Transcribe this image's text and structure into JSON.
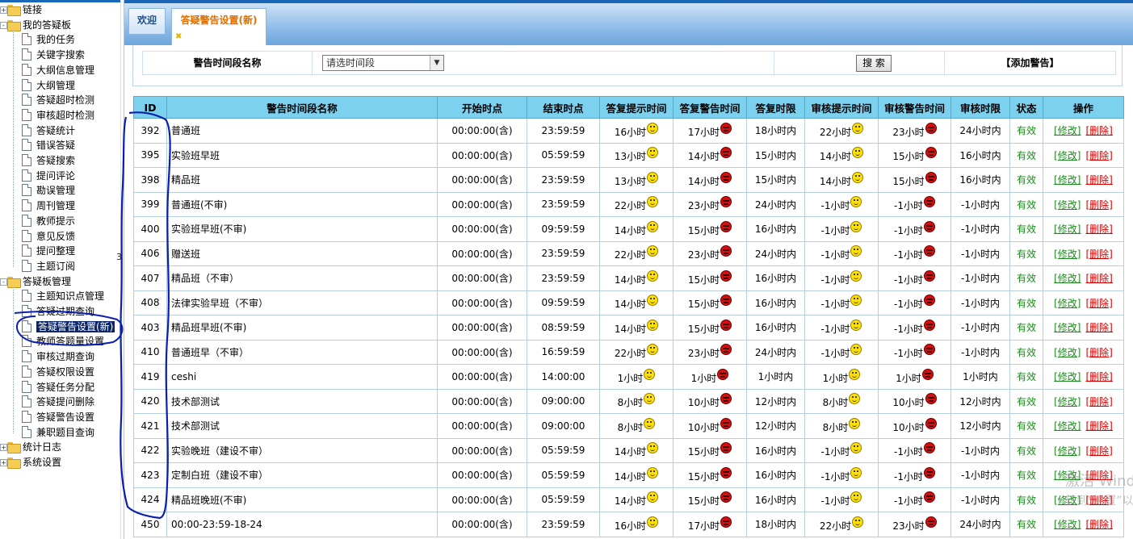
{
  "sidebar": {
    "nodes": [
      {
        "label": "链接",
        "kind": "folder",
        "level": 0,
        "expander": "+"
      },
      {
        "label": "我的答疑板",
        "kind": "folder",
        "level": 0,
        "expander": "-"
      },
      {
        "label": "我的任务",
        "kind": "doc",
        "level": 1
      },
      {
        "label": "关键字搜索",
        "kind": "doc",
        "level": 1
      },
      {
        "label": "大纲信息管理",
        "kind": "doc",
        "level": 1
      },
      {
        "label": "大纲管理",
        "kind": "doc",
        "level": 1
      },
      {
        "label": "答疑超时检测",
        "kind": "doc",
        "level": 1
      },
      {
        "label": "审核超时检测",
        "kind": "doc",
        "level": 1
      },
      {
        "label": "答疑统计",
        "kind": "doc",
        "level": 1
      },
      {
        "label": "错误答疑",
        "kind": "doc",
        "level": 1
      },
      {
        "label": "答疑搜索",
        "kind": "doc",
        "level": 1
      },
      {
        "label": "提问评论",
        "kind": "doc",
        "level": 1
      },
      {
        "label": "勘误管理",
        "kind": "doc",
        "level": 1
      },
      {
        "label": "周刊管理",
        "kind": "doc",
        "level": 1
      },
      {
        "label": "教师提示",
        "kind": "doc",
        "level": 1
      },
      {
        "label": "意见反馈",
        "kind": "doc",
        "level": 1
      },
      {
        "label": "提问整理",
        "kind": "doc",
        "level": 1
      },
      {
        "label": "主题订阅",
        "kind": "doc",
        "level": 1
      },
      {
        "label": "答疑板管理",
        "kind": "folder",
        "level": 0,
        "expander": "-"
      },
      {
        "label": "主题知识点管理",
        "kind": "doc",
        "level": 1
      },
      {
        "label": "答疑过期查询",
        "kind": "doc",
        "level": 1
      },
      {
        "label": "答疑警告设置(新)",
        "kind": "doc",
        "level": 1,
        "active": true
      },
      {
        "label": "教师答题量设置",
        "kind": "doc",
        "level": 1
      },
      {
        "label": "审核过期查询",
        "kind": "doc",
        "level": 1
      },
      {
        "label": "答疑权限设置",
        "kind": "doc",
        "level": 1
      },
      {
        "label": "答疑任务分配",
        "kind": "doc",
        "level": 1
      },
      {
        "label": "答疑提问删除",
        "kind": "doc",
        "level": 1
      },
      {
        "label": "答疑警告设置",
        "kind": "doc",
        "level": 1
      },
      {
        "label": "兼职题目查询",
        "kind": "doc",
        "level": 1
      },
      {
        "label": "统计日志",
        "kind": "folder",
        "level": 0,
        "expander": "+"
      },
      {
        "label": "系统设置",
        "kind": "folder",
        "level": 0,
        "expander": "+"
      }
    ]
  },
  "tabs": {
    "welcome": "欢迎",
    "active": "答疑警告设置(新)",
    "close_glyph": "✖"
  },
  "search": {
    "label": "警告时间段名称",
    "select_value": "请选时间段",
    "button": "搜 索",
    "add_link": "【添加警告】"
  },
  "table": {
    "headers": [
      "ID",
      "警告时间段名称",
      "开始时点",
      "结束时点",
      "答复提示时间",
      "答复警告时间",
      "答复时限",
      "审核提示时间",
      "审核警告时间",
      "审核时限",
      "状态",
      "操作"
    ],
    "modify_label": "[修改]",
    "delete_label": "[删除]",
    "rows": [
      {
        "id": "392",
        "name": "普通班",
        "start": "00:00:00(含)",
        "end": "23:59:59",
        "reply_hint": "16小时",
        "reply_warn": "17小时",
        "reply_limit": "18小时内",
        "audit_hint": "22小时",
        "audit_warn": "23小时",
        "audit_limit": "24小时内",
        "status": "有效"
      },
      {
        "id": "395",
        "name": "实验班早班",
        "start": "00:00:00(含)",
        "end": "05:59:59",
        "reply_hint": "13小时",
        "reply_warn": "14小时",
        "reply_limit": "15小时内",
        "audit_hint": "14小时",
        "audit_warn": "15小时",
        "audit_limit": "16小时内",
        "status": "有效"
      },
      {
        "id": "398",
        "name": "精品班",
        "start": "00:00:00(含)",
        "end": "23:59:59",
        "reply_hint": "13小时",
        "reply_warn": "14小时",
        "reply_limit": "15小时内",
        "audit_hint": "14小时",
        "audit_warn": "15小时",
        "audit_limit": "16小时内",
        "status": "有效"
      },
      {
        "id": "399",
        "name": "普通班(不审)",
        "start": "00:00:00(含)",
        "end": "23:59:59",
        "reply_hint": "22小时",
        "reply_warn": "23小时",
        "reply_limit": "24小时内",
        "audit_hint": "-1小时",
        "audit_warn": "-1小时",
        "audit_limit": "-1小时内",
        "status": "有效"
      },
      {
        "id": "400",
        "name": "实验班早班(不审)",
        "start": "00:00:00(含)",
        "end": "09:59:59",
        "reply_hint": "14小时",
        "reply_warn": "15小时",
        "reply_limit": "16小时内",
        "audit_hint": "-1小时",
        "audit_warn": "-1小时",
        "audit_limit": "-1小时内",
        "status": "有效"
      },
      {
        "id": "406",
        "name": "赠送班",
        "start": "00:00:00(含)",
        "end": "23:59:59",
        "reply_hint": "22小时",
        "reply_warn": "23小时",
        "reply_limit": "24小时内",
        "audit_hint": "-1小时",
        "audit_warn": "-1小时",
        "audit_limit": "-1小时内",
        "status": "有效"
      },
      {
        "id": "407",
        "name": "精品班（不审）",
        "start": "00:00:00(含)",
        "end": "23:59:59",
        "reply_hint": "14小时",
        "reply_warn": "15小时",
        "reply_limit": "16小时内",
        "audit_hint": "-1小时",
        "audit_warn": "-1小时",
        "audit_limit": "-1小时内",
        "status": "有效"
      },
      {
        "id": "408",
        "name": "法律实验早班（不审）",
        "start": "00:00:00(含)",
        "end": "09:59:59",
        "reply_hint": "14小时",
        "reply_warn": "15小时",
        "reply_limit": "16小时内",
        "audit_hint": "-1小时",
        "audit_warn": "-1小时",
        "audit_limit": "-1小时内",
        "status": "有效"
      },
      {
        "id": "403",
        "name": "精品班早班(不审)",
        "start": "00:00:00(含)",
        "end": "08:59:59",
        "reply_hint": "14小时",
        "reply_warn": "15小时",
        "reply_limit": "16小时内",
        "audit_hint": "-1小时",
        "audit_warn": "-1小时",
        "audit_limit": "-1小时内",
        "status": "有效"
      },
      {
        "id": "410",
        "name": "普通班早（不审）",
        "start": "00:00:00(含)",
        "end": "16:59:59",
        "reply_hint": "22小时",
        "reply_warn": "23小时",
        "reply_limit": "24小时内",
        "audit_hint": "-1小时",
        "audit_warn": "-1小时",
        "audit_limit": "-1小时内",
        "status": "有效"
      },
      {
        "id": "419",
        "name": "ceshi",
        "start": "00:00:00(含)",
        "end": "14:00:00",
        "reply_hint": "1小时",
        "reply_warn": "1小时",
        "reply_limit": "1小时内",
        "audit_hint": "1小时",
        "audit_warn": "1小时",
        "audit_limit": "1小时内",
        "status": "有效"
      },
      {
        "id": "420",
        "name": "技术部测试",
        "start": "00:00:00(含)",
        "end": "09:00:00",
        "reply_hint": "8小时",
        "reply_warn": "10小时",
        "reply_limit": "12小时内",
        "audit_hint": "8小时",
        "audit_warn": "10小时",
        "audit_limit": "12小时内",
        "status": "有效"
      },
      {
        "id": "421",
        "name": "技术部测试",
        "start": "00:00:00(含)",
        "end": "09:00:00",
        "reply_hint": "8小时",
        "reply_warn": "10小时",
        "reply_limit": "12小时内",
        "audit_hint": "8小时",
        "audit_warn": "10小时",
        "audit_limit": "12小时内",
        "status": "有效"
      },
      {
        "id": "422",
        "name": "实验晚班（建设不审）",
        "start": "00:00:00(含)",
        "end": "05:59:59",
        "reply_hint": "14小时",
        "reply_warn": "15小时",
        "reply_limit": "16小时内",
        "audit_hint": "-1小时",
        "audit_warn": "-1小时",
        "audit_limit": "-1小时内",
        "status": "有效"
      },
      {
        "id": "423",
        "name": "定制白班（建设不审）",
        "start": "00:00:00(含)",
        "end": "05:59:59",
        "reply_hint": "14小时",
        "reply_warn": "15小时",
        "reply_limit": "16小时内",
        "audit_hint": "-1小时",
        "audit_warn": "-1小时",
        "audit_limit": "-1小时内",
        "status": "有效"
      },
      {
        "id": "424",
        "name": "精品班晚班(不审)",
        "start": "00:00:00(含)",
        "end": "05:59:59",
        "reply_hint": "14小时",
        "reply_warn": "15小时",
        "reply_limit": "16小时内",
        "audit_hint": "-1小时",
        "audit_warn": "-1小时",
        "audit_limit": "-1小时内",
        "status": "有效"
      },
      {
        "id": "450",
        "name": "00:00-23:59-18-24",
        "start": "00:00:00(含)",
        "end": "23:59:59",
        "reply_hint": "16小时",
        "reply_warn": "17小时",
        "reply_limit": "18小时内",
        "audit_hint": "22小时",
        "audit_warn": "23小时",
        "audit_limit": "24小时内",
        "status": "有效"
      }
    ]
  },
  "watermark": {
    "line1": "激活 Windows",
    "line2": "转到“设置”以激活 Windows。"
  },
  "annotation": {
    "stray_mark": "3",
    "ink_color": "#0a1fb0"
  }
}
